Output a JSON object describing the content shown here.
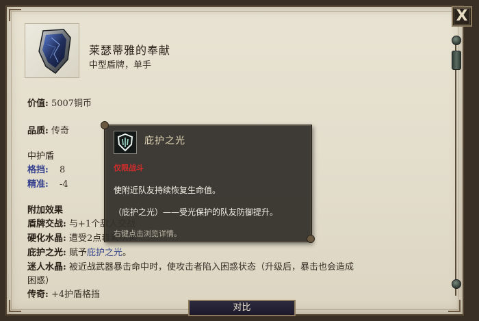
{
  "item": {
    "name": "莱瑟蒂雅的奉献",
    "subtitle": "中型盾牌，单手",
    "icon": "blue-shield-icon"
  },
  "stats": {
    "value_label": "价值:",
    "value": "5007铜币",
    "quality_label": "品质:",
    "quality": "传奇",
    "category": "中护盾",
    "block_label": "格挡:",
    "block": "8",
    "accuracy_label": "精准:",
    "accuracy": "-4"
  },
  "effects": {
    "header": "附加效果",
    "items": [
      {
        "label": "盾牌交战:",
        "text": "与+1个敌人交战"
      },
      {
        "label": "硬化水晶:",
        "text": "遭受2点毒素伤害"
      },
      {
        "label": "庇护之光:",
        "text_prefix": "赋予",
        "link": "庇护之光",
        "text_suffix": "。"
      },
      {
        "label": "迷人水晶:",
        "text": "被近战武器暴击命中时，使攻击者陷入困惑状态（升级后，暴击也会造成",
        "text_cont": "困惑）"
      },
      {
        "label": "传奇:",
        "text": "+4护盾格挡"
      }
    ]
  },
  "tooltip": {
    "icon": "shield-light-icon",
    "title": "庇护之光",
    "tag": "仅限战斗",
    "line1": "使附近队友持续恢复生命值。",
    "line2": "（庇护之光）——受光保护的队友防御提升。",
    "hint": "右键点击浏览详情。"
  },
  "buttons": {
    "close": "X",
    "compare": "对比"
  },
  "colors": {
    "parchment": "#e6e0cf",
    "stat_blue": "#34408c",
    "tooltip_bg": "#322e2a",
    "tag_red": "#d22c2c"
  }
}
